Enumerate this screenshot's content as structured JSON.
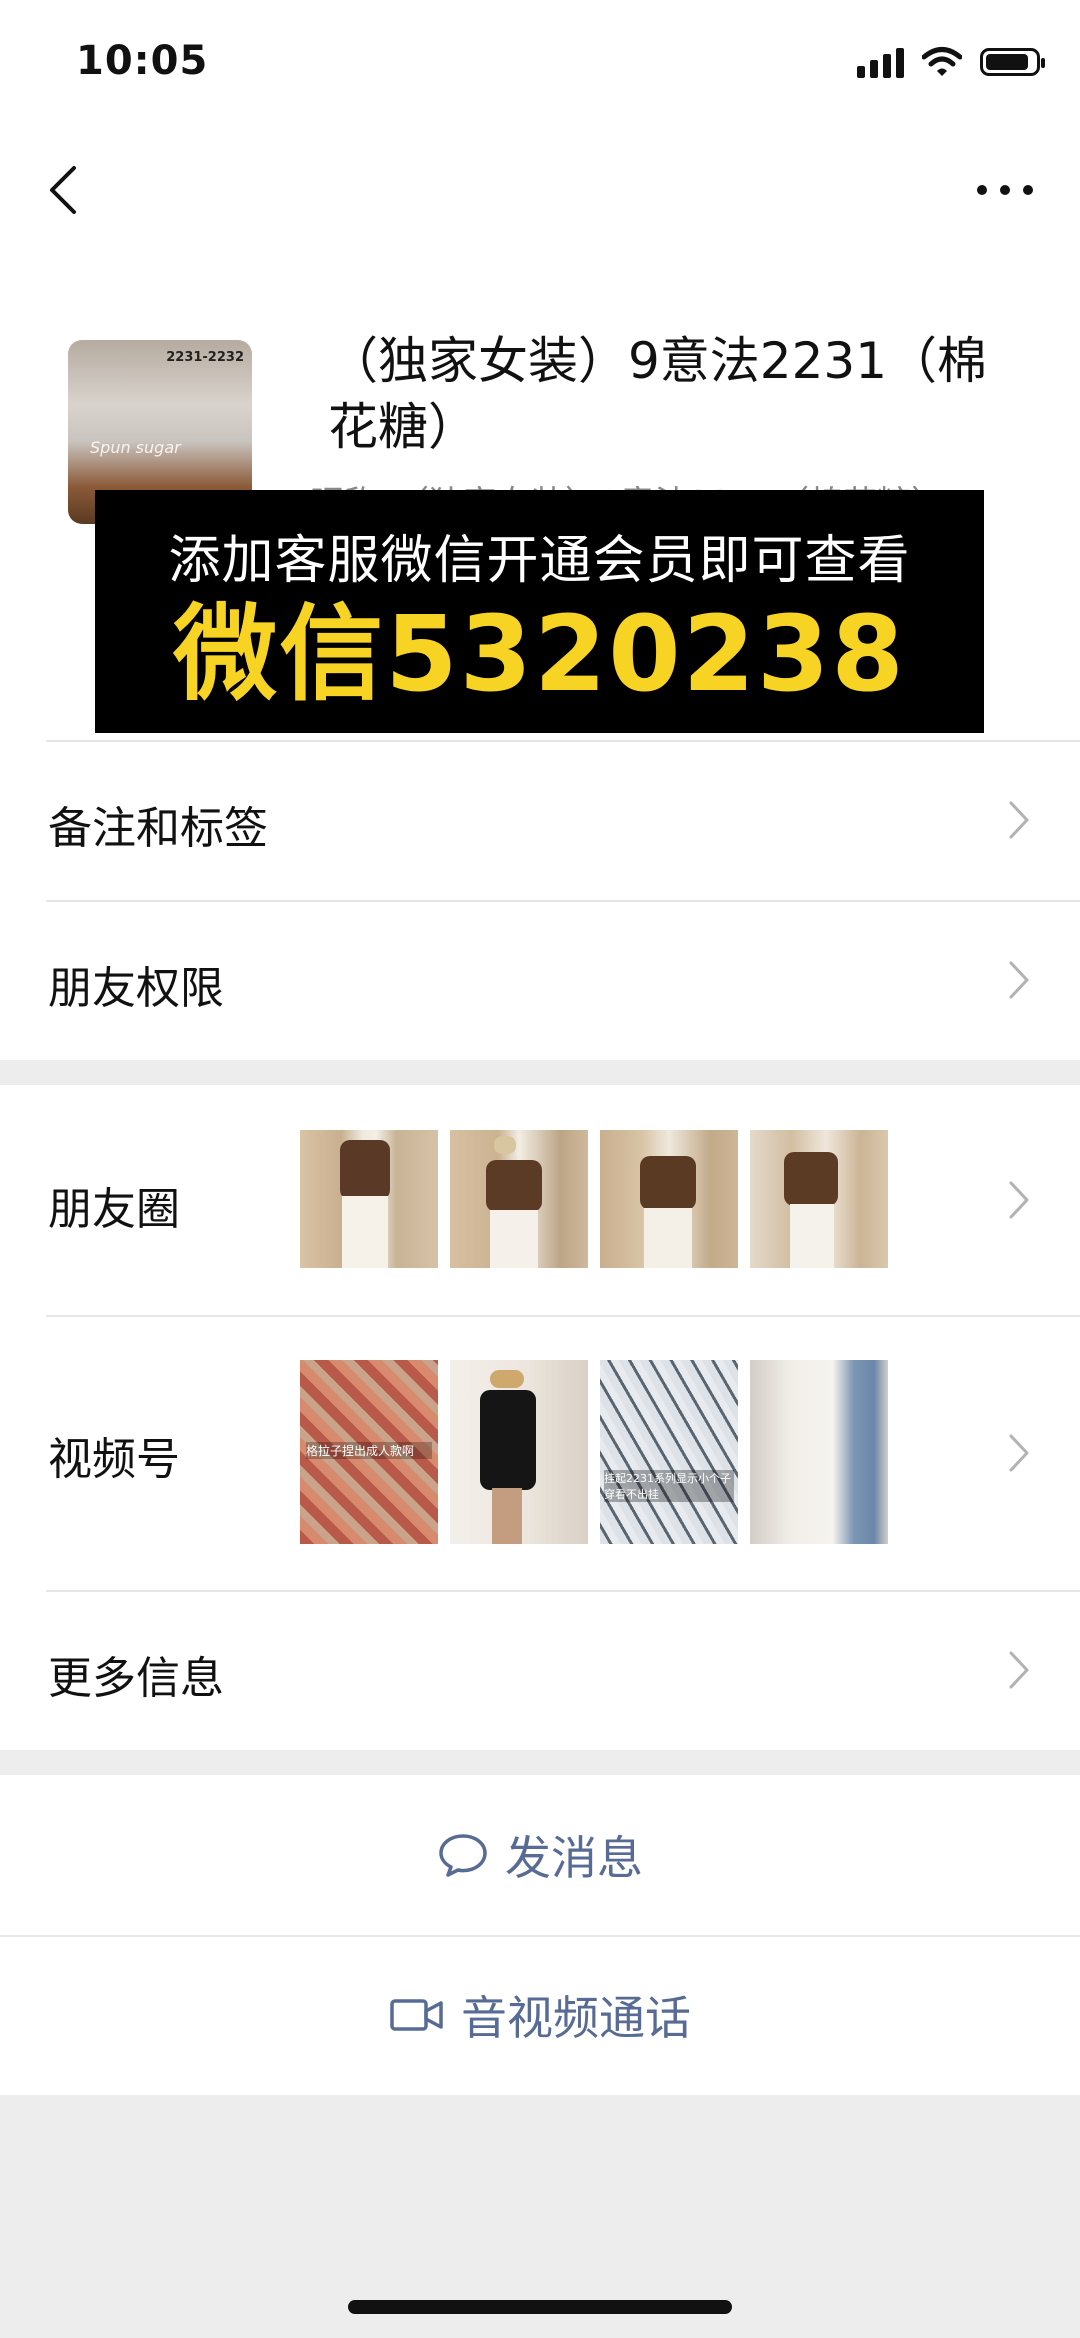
{
  "status_bar": {
    "time": "10:05"
  },
  "profile": {
    "name": "（独家女装）9意法2231（棉花糖）",
    "nickname_partial": "昵称：（独家女装）9意法2231（棉花糖）",
    "avatar_label": "2231-2232",
    "avatar_caption": "Spun sugar"
  },
  "promo": {
    "line1": "添加客服微信开通会员即可查看",
    "line2": "微信5320238"
  },
  "rows": {
    "remarks": "备注和标签",
    "permissions": "朋友权限",
    "moments": "朋友圈",
    "channels": "视频号",
    "more_info": "更多信息"
  },
  "channels_captions": [
    "格拉子捏出成人款啊",
    "",
    "挂起2231系列显示小个子穿看不出挂",
    ""
  ],
  "actions": {
    "message": "发消息",
    "call": "音视频通话"
  },
  "colors": {
    "link": "#576b95",
    "promo_yellow": "#f7d324",
    "background": "#ededed"
  },
  "icons": [
    "back-arrow-icon",
    "more-dots-icon",
    "chevron-right-icon",
    "chat-bubble-icon",
    "video-camera-icon",
    "signal-icon",
    "wifi-icon",
    "battery-icon"
  ]
}
